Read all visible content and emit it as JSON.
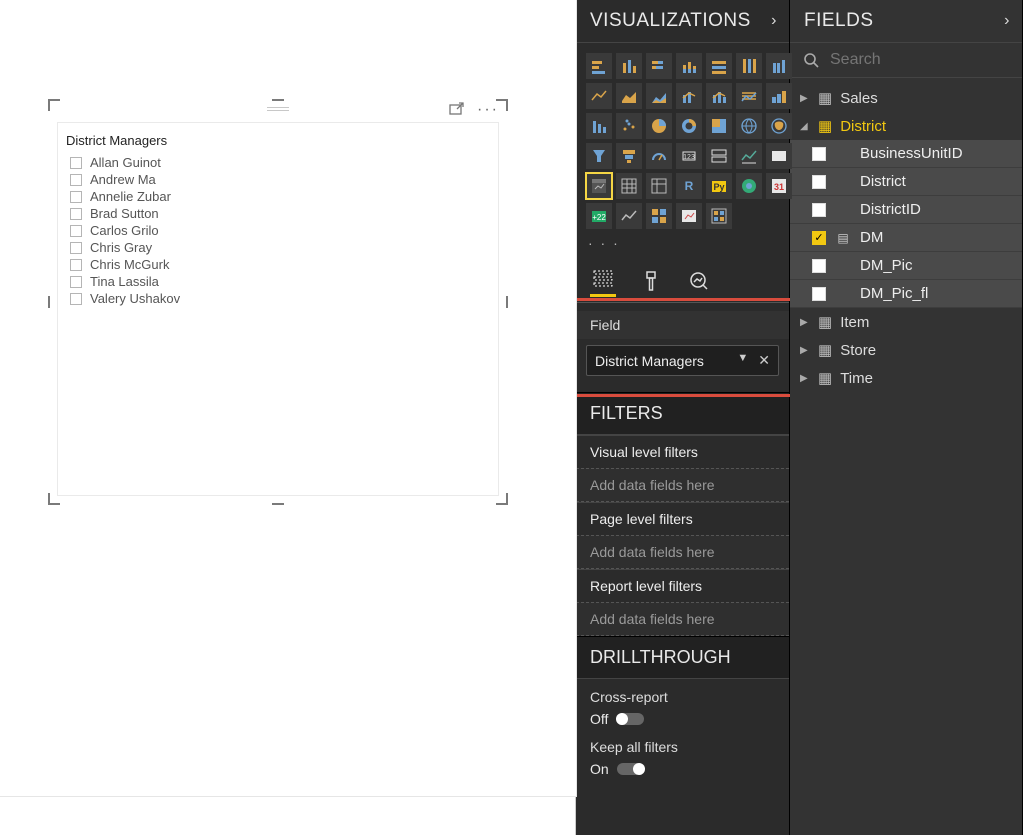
{
  "slicer": {
    "title": "District Managers",
    "items": [
      "Allan Guinot",
      "Andrew Ma",
      "Annelie Zubar",
      "Brad Sutton",
      "Carlos Grilo",
      "Chris Gray",
      "Chris McGurk",
      "Tina Lassila",
      "Valery Ushakov"
    ]
  },
  "visualizations": {
    "header": "VISUALIZATIONS",
    "ellipsis": "· · ·",
    "field_well_label": "Field",
    "field_chip": "District Managers",
    "filters_header": "FILTERS",
    "visual_level": "Visual level filters",
    "page_level": "Page level filters",
    "report_level": "Report level filters",
    "drop_text": "Add data fields here",
    "drill_header": "DRILLTHROUGH",
    "cross_report": "Cross-report",
    "off": "Off",
    "keep_all": "Keep all filters",
    "on": "On"
  },
  "fields": {
    "header": "FIELDS",
    "search_placeholder": "Search",
    "tables": {
      "sales": "Sales",
      "district": "District",
      "item": "Item",
      "store": "Store",
      "time": "Time"
    },
    "district_fields": [
      {
        "name": "BusinessUnitID",
        "checked": false,
        "type": ""
      },
      {
        "name": "District",
        "checked": false,
        "type": ""
      },
      {
        "name": "DistrictID",
        "checked": false,
        "type": ""
      },
      {
        "name": "DM",
        "checked": true,
        "type": "text"
      },
      {
        "name": "DM_Pic",
        "checked": false,
        "type": ""
      },
      {
        "name": "DM_Pic_fl",
        "checked": false,
        "type": ""
      }
    ]
  }
}
